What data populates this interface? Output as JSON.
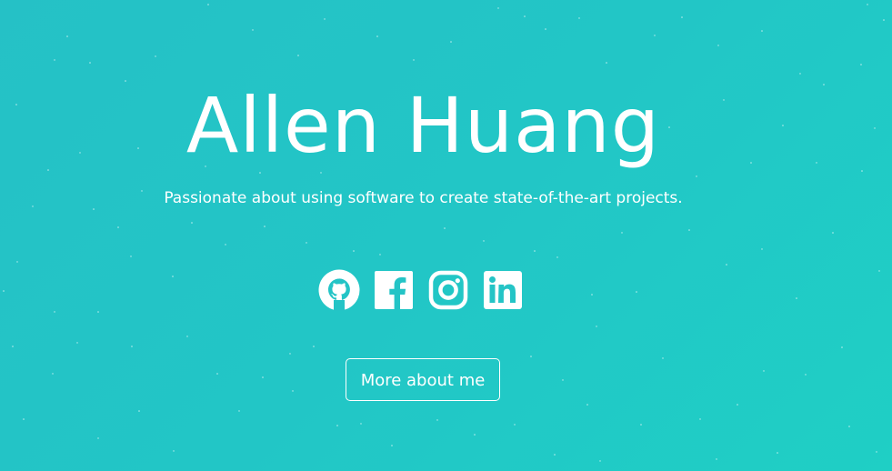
{
  "hero": {
    "name": "Allen Huang",
    "tagline": "Passionate about using software to create state-of-the-art projects.",
    "cta_label": "More about me"
  },
  "socials": [
    {
      "icon": "github-icon"
    },
    {
      "icon": "facebook-icon"
    },
    {
      "icon": "instagram-icon"
    },
    {
      "icon": "linkedin-icon"
    }
  ],
  "colors": {
    "background_start": "#25c1c6",
    "background_end": "#1fcfc5",
    "foreground": "#ffffff"
  }
}
